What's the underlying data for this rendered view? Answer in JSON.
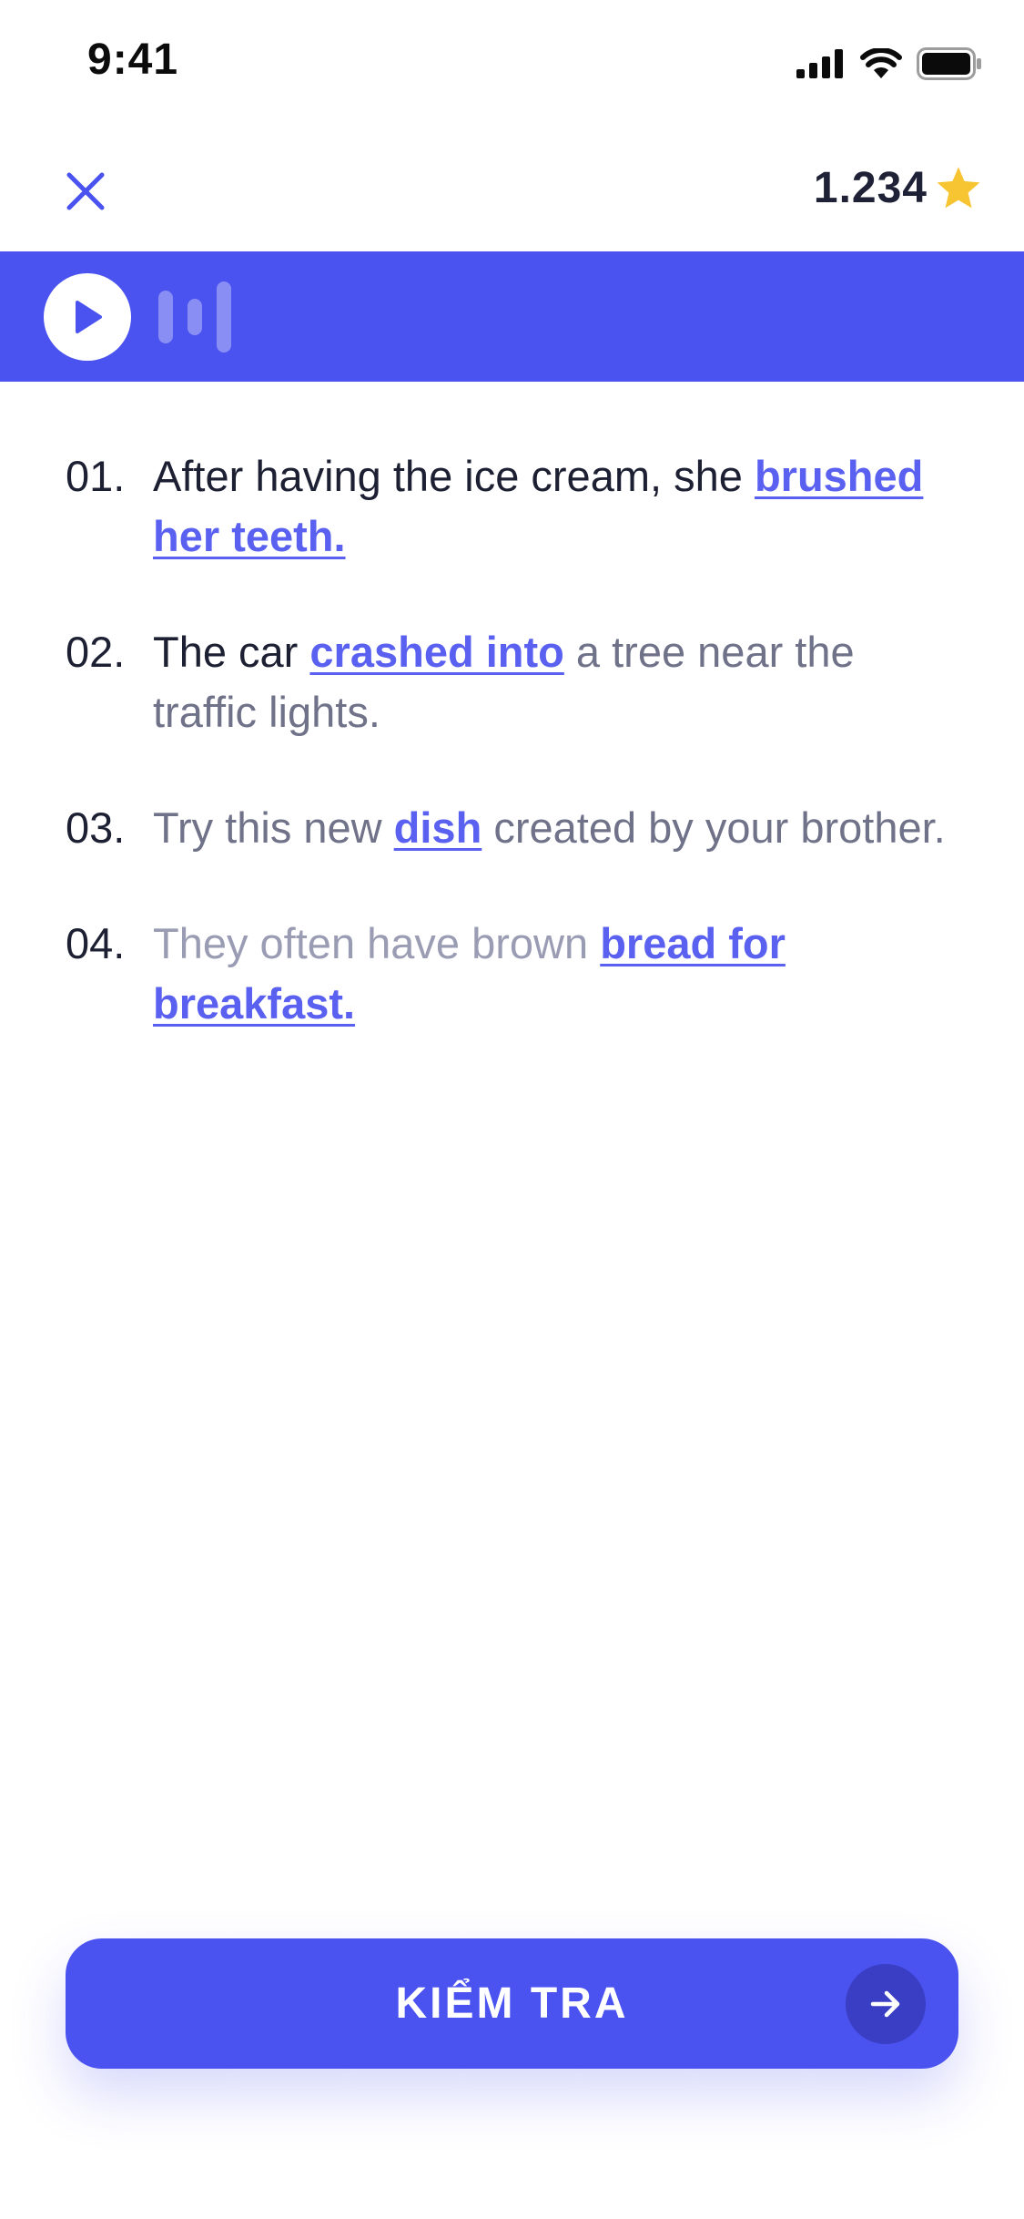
{
  "status_bar": {
    "time": "9:41",
    "icons": [
      "signal-icon",
      "wifi-icon",
      "battery-icon"
    ]
  },
  "header": {
    "close_icon": "close-icon",
    "score": "1.234",
    "score_icon": "star-icon"
  },
  "audio": {
    "play_icon": "play-icon",
    "wave_icon": "audio-wave-icon"
  },
  "sentences": [
    {
      "number": "01.",
      "text_before": "After having the ice cream, she",
      "answer": "brushed her teeth.",
      "text_after": ""
    },
    {
      "number": "02.",
      "text_before": "The car",
      "answer": "crashed into",
      "text_after": "a tree near the traffic lights."
    },
    {
      "number": "03.",
      "text_before": "Try this new",
      "answer": "dish",
      "text_after": "created by your brother."
    },
    {
      "number": "04.",
      "text_before": "They often have brown",
      "answer": "bread for breakfast.",
      "text_after": ""
    }
  ],
  "check_button": {
    "label": "KIỂM TRA",
    "icon": "arrow-right-icon"
  },
  "colors": {
    "accent": "#4a52ef",
    "link": "#5a61f1",
    "star": "#f7c531",
    "text_dark": "#1d2033"
  }
}
